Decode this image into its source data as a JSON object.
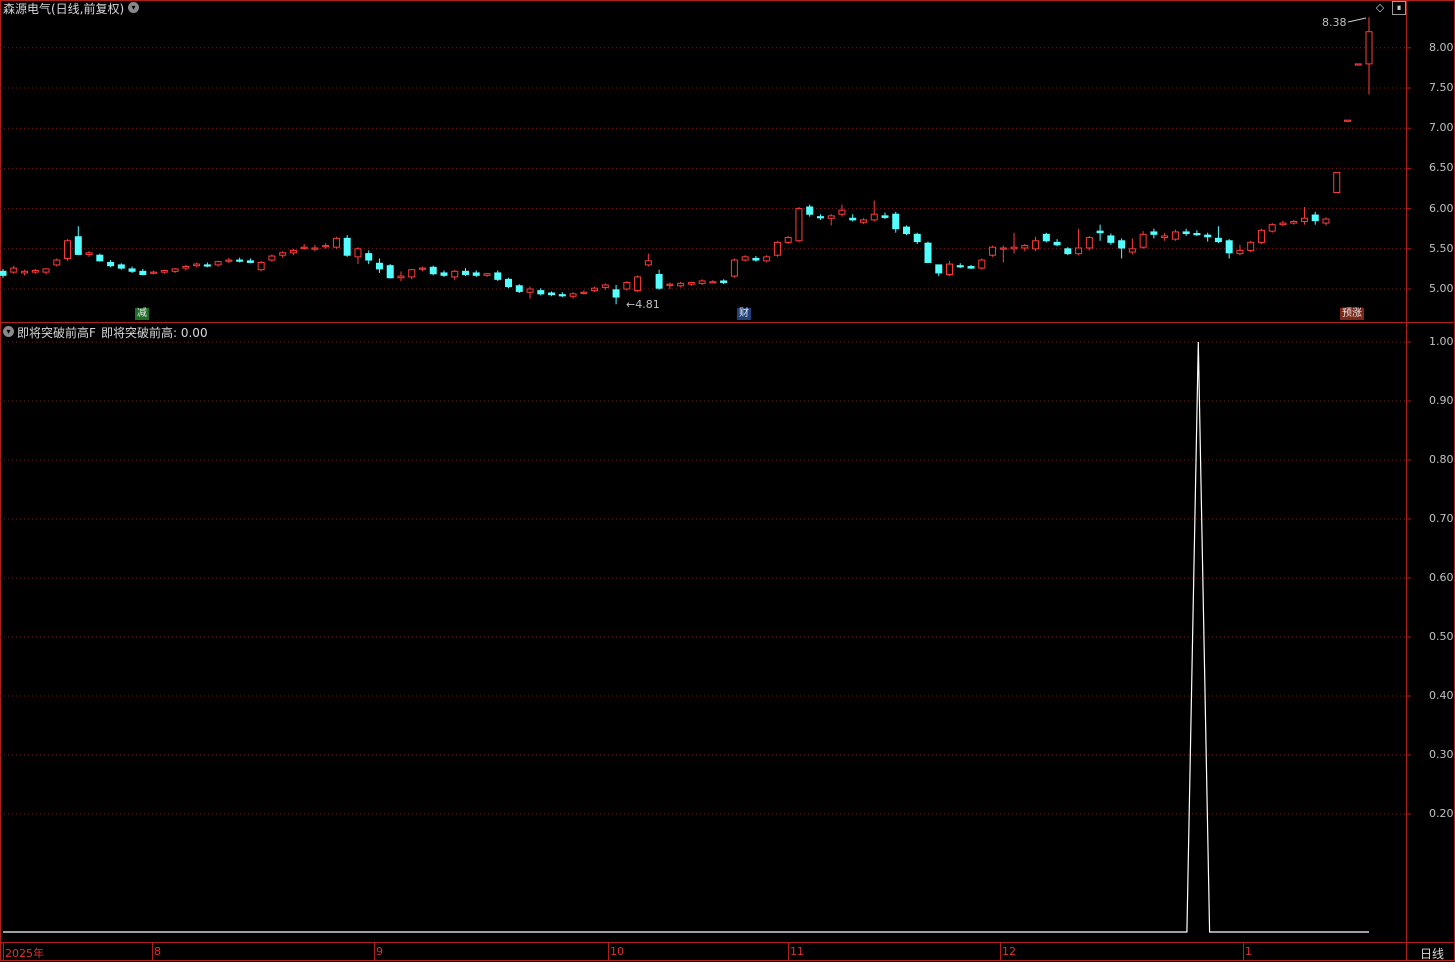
{
  "header": {
    "stock_title": "森源电气(日线,前复权)",
    "indicator_name": "即将突破前高F",
    "indicator_value": "即将突破前高: 0.00"
  },
  "price_axis": [
    "8.00",
    "7.50",
    "7.00",
    "6.50",
    "6.00",
    "5.50",
    "5.00"
  ],
  "indicator_axis": [
    "1.00",
    "0.90",
    "0.80",
    "0.70",
    "0.60",
    "0.50",
    "0.40",
    "0.30",
    "0.20"
  ],
  "annotations": {
    "high": "8.38",
    "low": "4.81"
  },
  "markers": [
    {
      "text": "减",
      "color": "#e8e8e8",
      "bg": "#1e6e28"
    },
    {
      "text": "财",
      "color": "#e8e8e8",
      "bg": "#20407a"
    },
    {
      "text": "预涨",
      "color": "#e8e8e8",
      "bg": "#7a2a1a"
    }
  ],
  "dates": [
    "2025年",
    "8",
    "9",
    "10",
    "11",
    "12",
    "1"
  ],
  "period_button": "日线",
  "colors": {
    "up": "#ff3b3b",
    "down": "#54ffff",
    "grid": "#7a1a1a",
    "border": "#b01e1e",
    "line": "#ffffff"
  },
  "indicator_values": [
    0,
    0,
    0,
    0,
    0,
    0,
    0,
    0,
    0,
    0,
    0,
    0,
    0,
    0,
    0,
    0,
    0,
    0,
    0,
    0,
    0,
    0,
    0,
    0,
    0,
    0,
    0,
    0,
    0,
    0,
    0,
    0,
    0,
    0,
    0,
    0,
    0,
    0,
    0,
    0,
    0,
    0,
    0,
    0,
    0,
    0,
    0,
    0,
    0,
    0,
    0,
    0,
    0,
    0,
    0,
    0,
    0,
    0,
    0,
    0,
    0,
    0,
    0,
    0,
    0,
    0,
    0,
    0,
    0,
    0,
    0,
    0,
    0,
    0,
    0,
    0,
    0,
    0,
    0,
    0,
    0,
    0,
    0,
    0,
    0,
    0,
    0,
    0,
    0,
    0,
    0,
    0,
    0,
    0,
    0,
    0,
    0,
    0,
    0,
    0,
    0,
    0,
    0,
    0,
    0,
    1,
    0,
    0,
    0,
    0,
    0,
    0,
    0,
    0,
    0,
    0,
    0,
    0,
    0,
    0,
    0
  ],
  "candles": [
    [
      5.22,
      5.25,
      5.14,
      5.17
    ],
    [
      5.21,
      5.29,
      5.19,
      5.26
    ],
    [
      5.2,
      5.24,
      5.17,
      5.22
    ],
    [
      5.21,
      5.25,
      5.19,
      5.23
    ],
    [
      5.21,
      5.26,
      5.18,
      5.25
    ],
    [
      5.3,
      5.38,
      5.28,
      5.36
    ],
    [
      5.38,
      5.62,
      5.35,
      5.6
    ],
    [
      5.65,
      5.78,
      5.42,
      5.43
    ],
    [
      5.43,
      5.47,
      5.4,
      5.45
    ],
    [
      5.42,
      5.44,
      5.34,
      5.35
    ],
    [
      5.33,
      5.36,
      5.27,
      5.29
    ],
    [
      5.3,
      5.32,
      5.24,
      5.26
    ],
    [
      5.25,
      5.28,
      5.2,
      5.22
    ],
    [
      5.22,
      5.25,
      5.17,
      5.18
    ],
    [
      5.2,
      5.23,
      5.18,
      5.21
    ],
    [
      5.21,
      5.24,
      5.19,
      5.23
    ],
    [
      5.22,
      5.26,
      5.2,
      5.25
    ],
    [
      5.26,
      5.3,
      5.23,
      5.28
    ],
    [
      5.29,
      5.33,
      5.27,
      5.31
    ],
    [
      5.3,
      5.33,
      5.27,
      5.29
    ],
    [
      5.3,
      5.35,
      5.28,
      5.34
    ],
    [
      5.35,
      5.39,
      5.32,
      5.36
    ],
    [
      5.36,
      5.39,
      5.33,
      5.35
    ],
    [
      5.35,
      5.38,
      5.32,
      5.33
    ],
    [
      5.24,
      5.35,
      5.22,
      5.33
    ],
    [
      5.36,
      5.43,
      5.34,
      5.41
    ],
    [
      5.42,
      5.47,
      5.39,
      5.45
    ],
    [
      5.45,
      5.5,
      5.42,
      5.48
    ],
    [
      5.51,
      5.56,
      5.49,
      5.52
    ],
    [
      5.5,
      5.55,
      5.47,
      5.51
    ],
    [
      5.53,
      5.57,
      5.5,
      5.54
    ],
    [
      5.52,
      5.65,
      5.5,
      5.63
    ],
    [
      5.63,
      5.67,
      5.4,
      5.42
    ],
    [
      5.4,
      5.52,
      5.31,
      5.5
    ],
    [
      5.44,
      5.48,
      5.31,
      5.36
    ],
    [
      5.32,
      5.38,
      5.2,
      5.25
    ],
    [
      5.29,
      5.31,
      5.13,
      5.14
    ],
    [
      5.14,
      5.22,
      5.1,
      5.16
    ],
    [
      5.15,
      5.25,
      5.12,
      5.24
    ],
    [
      5.25,
      5.28,
      5.22,
      5.26
    ],
    [
      5.27,
      5.29,
      5.17,
      5.19
    ],
    [
      5.2,
      5.23,
      5.15,
      5.17
    ],
    [
      5.15,
      5.24,
      5.11,
      5.22
    ],
    [
      5.22,
      5.26,
      5.16,
      5.18
    ],
    [
      5.2,
      5.23,
      5.15,
      5.17
    ],
    [
      5.17,
      5.2,
      5.15,
      5.19
    ],
    [
      5.2,
      5.23,
      5.1,
      5.12
    ],
    [
      5.12,
      5.14,
      5.01,
      5.03
    ],
    [
      5.04,
      5.06,
      4.95,
      4.97
    ],
    [
      4.96,
      5.03,
      4.88,
      5.0
    ],
    [
      4.98,
      5.01,
      4.92,
      4.94
    ],
    [
      4.95,
      4.97,
      4.91,
      4.93
    ],
    [
      4.93,
      4.96,
      4.9,
      4.92
    ],
    [
      4.91,
      4.96,
      4.88,
      4.94
    ],
    [
      4.95,
      4.98,
      4.93,
      4.96
    ],
    [
      4.98,
      5.03,
      4.96,
      5.01
    ],
    [
      5.02,
      5.07,
      4.99,
      5.05
    ],
    [
      4.99,
      5.05,
      4.81,
      4.9
    ],
    [
      5.0,
      5.1,
      4.98,
      5.08
    ],
    [
      4.98,
      5.17,
      4.96,
      5.15
    ],
    [
      5.3,
      5.44,
      5.28,
      5.35
    ],
    [
      5.18,
      5.24,
      4.99,
      5.01
    ],
    [
      5.05,
      5.08,
      5.0,
      5.06
    ],
    [
      5.04,
      5.09,
      5.02,
      5.07
    ],
    [
      5.06,
      5.09,
      5.04,
      5.08
    ],
    [
      5.07,
      5.12,
      5.05,
      5.1
    ],
    [
      5.09,
      5.11,
      5.07,
      5.09
    ],
    [
      5.1,
      5.12,
      5.06,
      5.08
    ],
    [
      5.16,
      5.38,
      5.14,
      5.36
    ],
    [
      5.36,
      5.42,
      5.34,
      5.4
    ],
    [
      5.38,
      5.41,
      5.34,
      5.36
    ],
    [
      5.35,
      5.42,
      5.33,
      5.4
    ],
    [
      5.42,
      5.6,
      5.4,
      5.58
    ],
    [
      5.58,
      5.66,
      5.56,
      5.64
    ],
    [
      5.6,
      6.02,
      5.58,
      6.0
    ],
    [
      6.02,
      6.05,
      5.9,
      5.93
    ],
    [
      5.9,
      5.93,
      5.86,
      5.89
    ],
    [
      5.88,
      5.93,
      5.79,
      5.91
    ],
    [
      5.93,
      6.05,
      5.9,
      5.98
    ],
    [
      5.88,
      5.93,
      5.84,
      5.86
    ],
    [
      5.83,
      5.88,
      5.81,
      5.86
    ],
    [
      5.86,
      6.1,
      5.84,
      5.93
    ],
    [
      5.91,
      5.95,
      5.87,
      5.89
    ],
    [
      5.93,
      5.96,
      5.7,
      5.75
    ],
    [
      5.77,
      5.79,
      5.67,
      5.69
    ],
    [
      5.68,
      5.7,
      5.56,
      5.59
    ],
    [
      5.57,
      5.59,
      5.33,
      5.33
    ],
    [
      5.3,
      5.3,
      5.16,
      5.2
    ],
    [
      5.18,
      5.35,
      5.16,
      5.31
    ],
    [
      5.29,
      5.32,
      5.26,
      5.28
    ],
    [
      5.28,
      5.3,
      5.25,
      5.26
    ],
    [
      5.26,
      5.38,
      5.24,
      5.36
    ],
    [
      5.42,
      5.54,
      5.4,
      5.52
    ],
    [
      5.5,
      5.54,
      5.33,
      5.51
    ],
    [
      5.5,
      5.7,
      5.44,
      5.52
    ],
    [
      5.51,
      5.56,
      5.47,
      5.54
    ],
    [
      5.5,
      5.65,
      5.47,
      5.6
    ],
    [
      5.68,
      5.7,
      5.58,
      5.6
    ],
    [
      5.58,
      5.62,
      5.53,
      5.55
    ],
    [
      5.5,
      5.52,
      5.42,
      5.44
    ],
    [
      5.44,
      5.75,
      5.42,
      5.51
    ],
    [
      5.51,
      5.66,
      5.48,
      5.64
    ],
    [
      5.72,
      5.8,
      5.6,
      5.7
    ],
    [
      5.66,
      5.69,
      5.55,
      5.58
    ],
    [
      5.6,
      5.63,
      5.38,
      5.51
    ],
    [
      5.46,
      5.63,
      5.43,
      5.5
    ],
    [
      5.52,
      5.72,
      5.5,
      5.68
    ],
    [
      5.71,
      5.75,
      5.63,
      5.68
    ],
    [
      5.64,
      5.7,
      5.6,
      5.66
    ],
    [
      5.62,
      5.74,
      5.6,
      5.71
    ],
    [
      5.71,
      5.75,
      5.66,
      5.69
    ],
    [
      5.69,
      5.73,
      5.66,
      5.68
    ],
    [
      5.67,
      5.7,
      5.59,
      5.65
    ],
    [
      5.63,
      5.78,
      5.57,
      5.59
    ],
    [
      5.6,
      5.62,
      5.38,
      5.45
    ],
    [
      5.44,
      5.55,
      5.42,
      5.48
    ],
    [
      5.48,
      5.6,
      5.46,
      5.58
    ],
    [
      5.58,
      5.75,
      5.56,
      5.73
    ],
    [
      5.72,
      5.82,
      5.7,
      5.8
    ],
    [
      5.8,
      5.85,
      5.78,
      5.82
    ],
    [
      5.82,
      5.86,
      5.8,
      5.84
    ],
    [
      5.84,
      6.02,
      5.8,
      5.88
    ],
    [
      5.92,
      5.96,
      5.8,
      5.85
    ],
    [
      5.82,
      5.89,
      5.79,
      5.87
    ],
    [
      6.2,
      6.45,
      6.2,
      6.45
    ],
    [
      7.1,
      7.1,
      7.1,
      7.1
    ],
    [
      7.8,
      7.8,
      7.8,
      7.8
    ],
    [
      7.8,
      8.38,
      7.42,
      8.2
    ]
  ]
}
